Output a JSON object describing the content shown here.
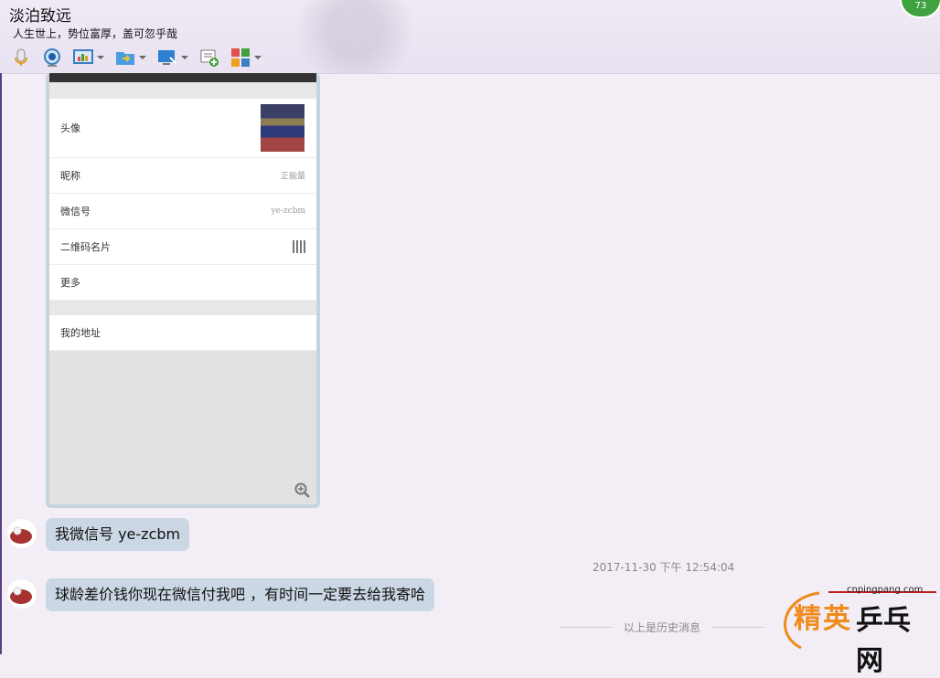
{
  "header": {
    "contact_name": "淡泊致远",
    "signature": "人生世上，势位富厚，盖可忽乎哉",
    "badge_count": "73",
    "toolbar": [
      {
        "icon": "microphone-icon",
        "has_dropdown": false
      },
      {
        "icon": "webcam-icon",
        "has_dropdown": false
      },
      {
        "icon": "screen-share-icon",
        "has_dropdown": true
      },
      {
        "icon": "send-file-icon",
        "has_dropdown": true
      },
      {
        "icon": "remote-assist-icon",
        "has_dropdown": true
      },
      {
        "icon": "add-chat-icon",
        "has_dropdown": false
      },
      {
        "icon": "apps-grid-icon",
        "has_dropdown": true
      }
    ]
  },
  "profile_screenshot": {
    "rows": [
      {
        "label": "头像",
        "value": ""
      },
      {
        "label": "昵称",
        "value": "正能量"
      },
      {
        "label": "微信号",
        "value": "ye-zcbm"
      },
      {
        "label": "二维码名片",
        "value": ""
      },
      {
        "label": "更多",
        "value": ""
      },
      {
        "label": "我的地址",
        "value": ""
      }
    ]
  },
  "messages": [
    {
      "text": "我微信号   ye-zcbm"
    },
    {
      "text": "球龄差价钱你现在微信付我吧 ，有时间一定要去给我寄哈"
    }
  ],
  "timestamp": "2017-11-30 下午 12:54:04",
  "history_divider": "以上是历史消息",
  "watermark": {
    "url": "cnpingpang.com",
    "text_orange": "精英",
    "text_black": "乒乓网"
  },
  "colors": {
    "bubble": "#cbd7e4",
    "header_bg": "#efeaf5",
    "badge": "#3fa23f",
    "accent_orange": "#f08b1e"
  }
}
